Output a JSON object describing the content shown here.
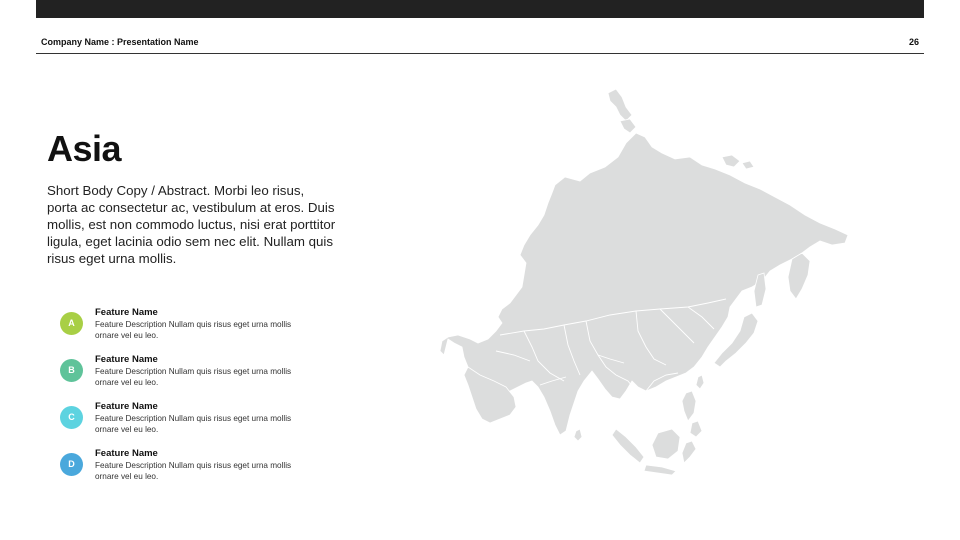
{
  "header": {
    "left_label": "Company Name : Presentation Name",
    "page_number": "26"
  },
  "slide": {
    "title": "Asia",
    "body": "Short Body Copy / Abstract.  Morbi leo risus, porta ac consectetur ac, vestibulum at eros. Duis mollis, est non commodo luctus, nisi erat porttitor ligula, eget lacinia odio sem nec elit. Nullam quis risus eget urna mollis."
  },
  "features": [
    {
      "badge": "A",
      "color": "#a8cf45",
      "name": "Feature Name",
      "description": "Feature Description Nullam quis risus eget urna mollis ornare vel eu leo."
    },
    {
      "badge": "B",
      "color": "#5fc39a",
      "name": "Feature Name",
      "description": "Feature Description Nullam quis risus eget urna mollis ornare vel eu leo."
    },
    {
      "badge": "C",
      "color": "#5dd3e0",
      "name": "Feature Name",
      "description": "Feature Description Nullam quis risus eget urna mollis ornare vel eu leo."
    },
    {
      "badge": "D",
      "color": "#4aa8dc",
      "name": "Feature Name",
      "description": "Feature Description Nullam quis risus eget urna mollis ornare vel eu leo."
    }
  ],
  "map": {
    "region": "asia",
    "fill_color": "#dcdddd",
    "border_color": "#ffffff"
  }
}
